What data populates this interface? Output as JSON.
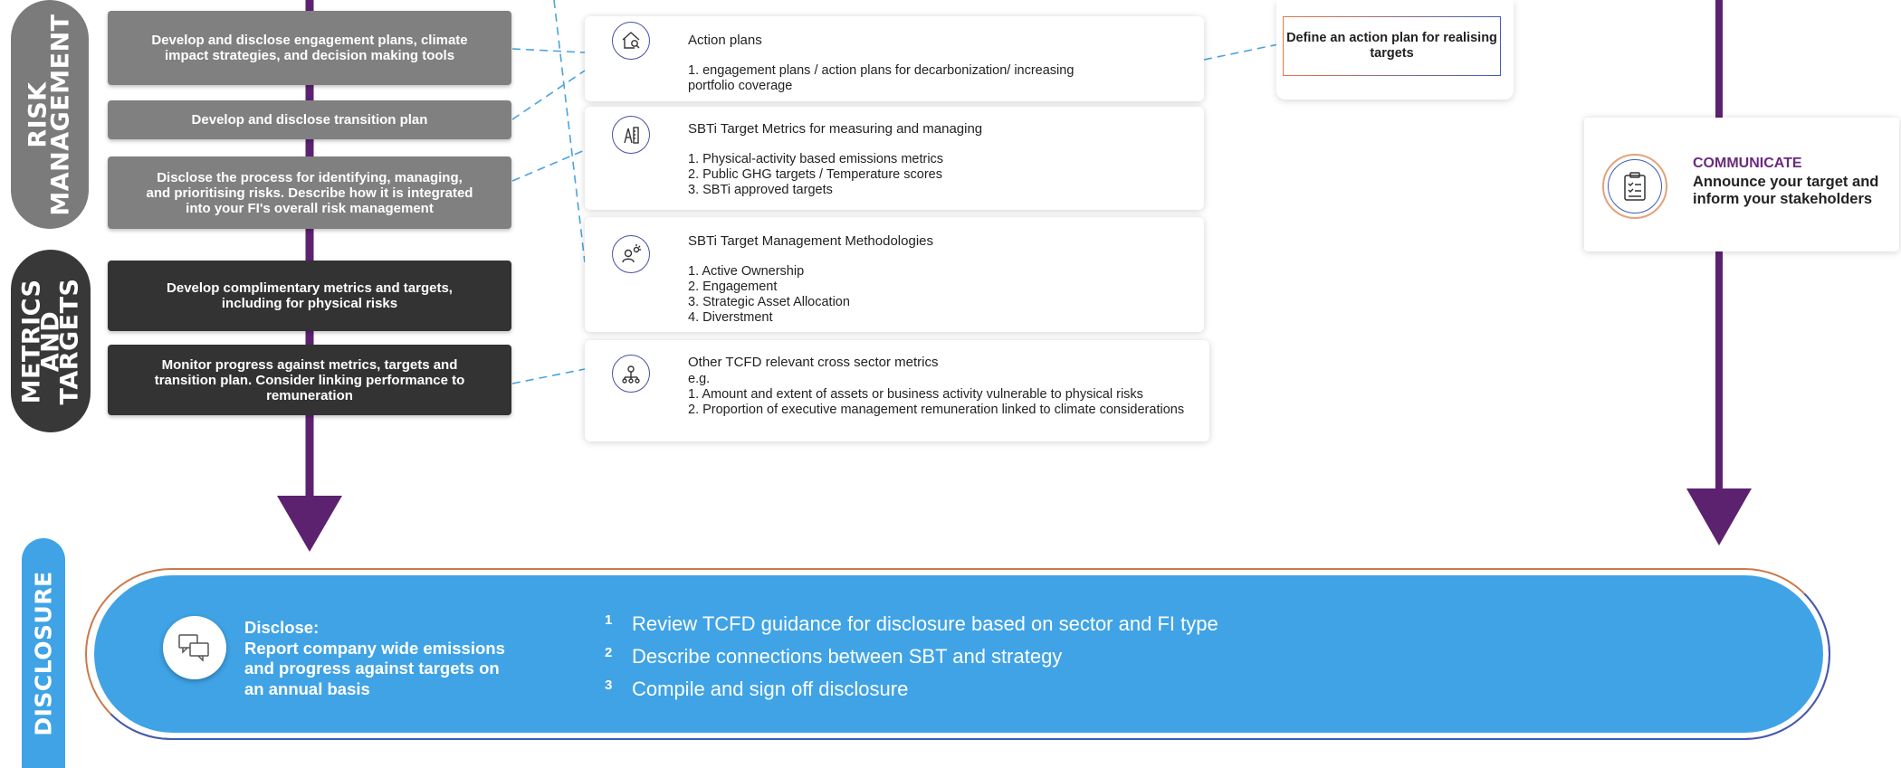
{
  "sections": {
    "risk_management": [
      "RISK",
      "MANAGEMENT"
    ],
    "metrics_targets": [
      "METRICS",
      "AND",
      "TARGETS"
    ],
    "disclosure": "DISCLOSURE"
  },
  "left_boxes": [
    {
      "text": "Develop and disclose engagement plans, climate impact strategies, and decision making tools"
    },
    {
      "text": "Develop and disclose transition plan"
    },
    {
      "text": "Disclose the process for identifying, managing, and prioritising risks. Describe how it is integrated into your FI's overall risk management"
    },
    {
      "text": "Develop complimentary metrics and targets, including for physical risks"
    },
    {
      "text": "Monitor progress against metrics, targets and transition plan. Consider linking performance to remuneration"
    }
  ],
  "cards": [
    {
      "icon": "house-search-icon",
      "title": "Action plans",
      "items": [
        "1. engagement plans / action plans for decarbonization/ increasing",
        "portfolio coverage"
      ]
    },
    {
      "icon": "pencil-ruler-icon",
      "title": "SBTi Target Metrics for measuring and managing",
      "items": [
        "1. Physical-activity based emissions metrics",
        "2. Public GHG targets / Temperature scores",
        "3. SBTi approved targets"
      ]
    },
    {
      "icon": "person-idea-icon",
      "title": "SBTi Target Management Methodologies",
      "items": [
        "1. Active Ownership",
        "2. Engagement",
        "3. Strategic Asset Allocation",
        "4. Diverstment"
      ]
    },
    {
      "icon": "network-bulb-icon",
      "title": "Other TCFD relevant cross sector metrics",
      "items": [
        "e.g.",
        "1. Amount and extent of assets or business activity vulnerable to physical risks",
        "2. Proportion of executive management remuneration linked to climate considerations"
      ]
    }
  ],
  "action_plan_box": "Define an action plan for realising targets",
  "communicate": {
    "title": "COMMUNICATE",
    "text": "Announce your target and inform your stakeholders"
  },
  "disclose": {
    "heading": "Disclose:",
    "text": "Report company wide emissions and progress against targets on an annual basis",
    "steps": [
      {
        "num": "1",
        "text": "Review TCFD guidance for disclosure based on sector and FI type"
      },
      {
        "num": "2",
        "text": "Describe connections between SBT and strategy"
      },
      {
        "num": "3",
        "text": "Compile and sign off disclosure"
      }
    ]
  },
  "colors": {
    "purple": "#5c2270",
    "grey_box": "#808080",
    "dark_box": "#333333",
    "disclosure_blue": "#3fa3e6",
    "dashed_line": "#4aa3e0"
  }
}
